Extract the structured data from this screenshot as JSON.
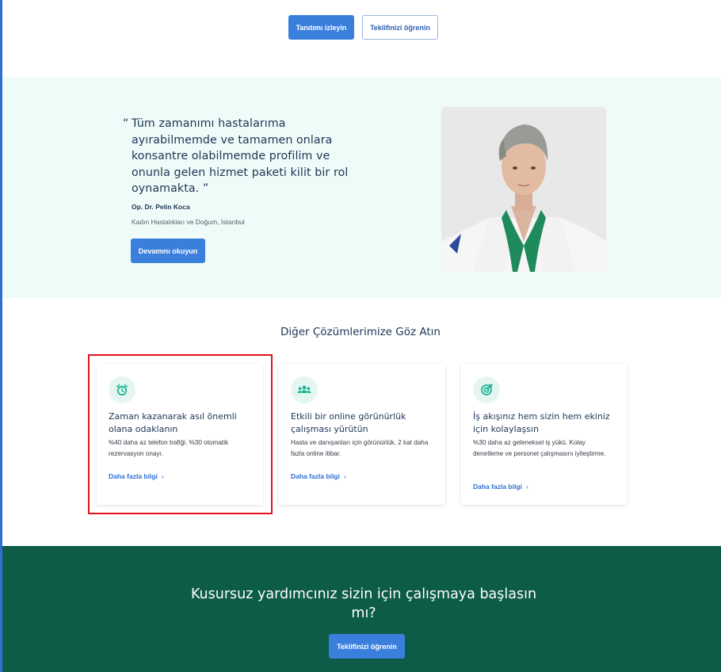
{
  "colors": {
    "accent": "#3b7fdd",
    "teal_bg": "#effbf8",
    "cta_bg": "#0d5c47",
    "icon_green": "#1fb592",
    "highlight": "#e0141b"
  },
  "top_actions": {
    "watch_intro_label": "Tanıtımı izleyin",
    "learn_offer_label": "Teklifinizi öğrenin"
  },
  "testimonial": {
    "quote_open": "“",
    "quote": "Tüm zamanımı hastalarıma\nayırabilmemde ve tamamen onlara\nkonsantre olabilmemde profilim ve\nonunla gelen hizmet paketi kilit bir rol\noynamakta. ”",
    "author_name": "Op. Dr. Pelin Koca",
    "author_title": "Kadın Hastalıkları ve Doğum, İstanbul",
    "read_more_label": "Devamını okuyun"
  },
  "solutions": {
    "title": "Diğer Çözümlerimize Göz Atın",
    "cards": [
      {
        "icon": "alarm-clock-icon",
        "title": "Zaman kazanarak asıl önemli olana odaklanın",
        "description": "%40 daha az telefon trafiği. %30 otomatik rezervasyon onayı.",
        "link_label": "Daha fazla bilgi",
        "link_chevron": "›"
      },
      {
        "icon": "people-group-icon",
        "title": "Etkili bir online görünürlük çalışması yürütün",
        "description": "Hasta ve danışanları için görünürlük. 2 kat daha fazla online itibar.",
        "link_label": "Daha fazla bilgi",
        "link_chevron": "›"
      },
      {
        "icon": "target-arrow-icon",
        "title": "İş akışınız hem sizin hem ekiniz için kolaylaşsın",
        "description": "%30 daha az geleneksel iş yükü. Kolay denetleme ve personel çalışmasını iyileştirme.",
        "link_label": "Daha fazla bilgi",
        "link_chevron": "›"
      }
    ]
  },
  "cta": {
    "title": "Kusursuz yardımcınız sizin için çalışmaya başlasın mı?",
    "button_label": "Teklifinizi öğrenin"
  }
}
